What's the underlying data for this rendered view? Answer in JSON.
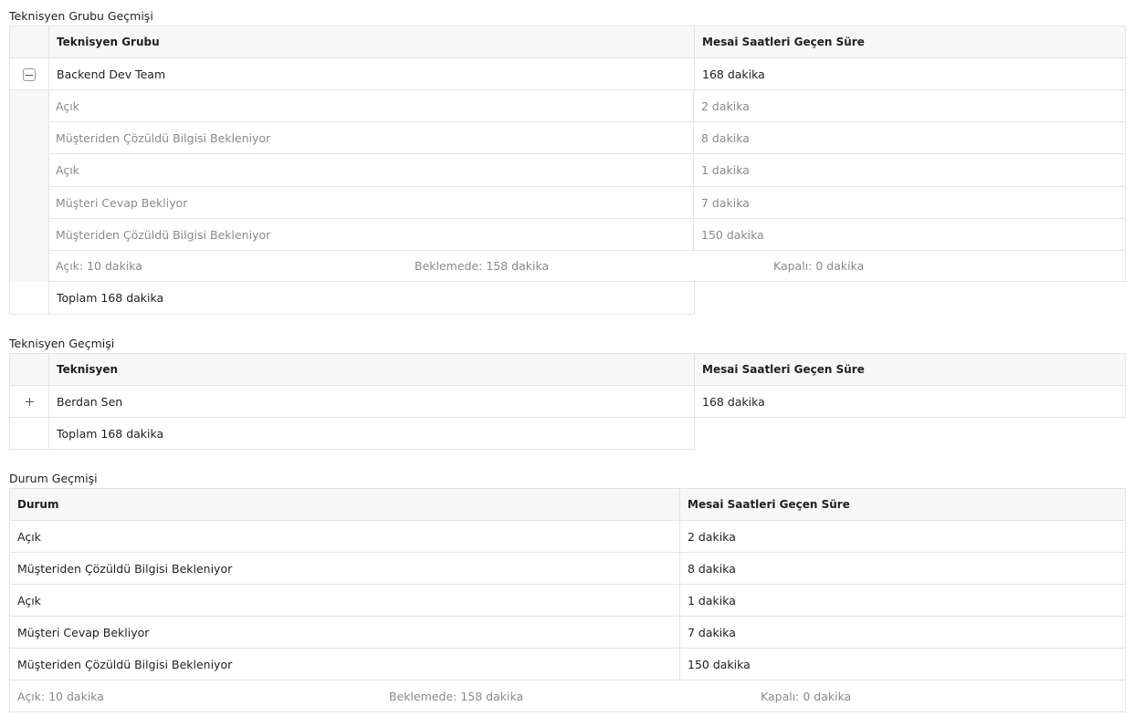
{
  "group_history": {
    "title": "Teknisyen Grubu Geçmişi",
    "col_group": "Teknisyen Grubu",
    "col_duration": "Mesai Saatleri Geçen Süre",
    "group_name": "Backend Dev Team",
    "group_duration": "168 dakika",
    "toggle_icon": "collapse-minus-icon",
    "sub_rows": [
      {
        "status": "Açık",
        "duration": "2 dakika"
      },
      {
        "status": "Müşteriden Çözüldü Bilgisi Bekleniyor",
        "duration": "8 dakika"
      },
      {
        "status": "Açık",
        "duration": "1 dakika"
      },
      {
        "status": "Müşteri Cevap Bekliyor",
        "duration": "7 dakika"
      },
      {
        "status": "Müşteriden Çözüldü Bilgisi Bekleniyor",
        "duration": "150 dakika"
      }
    ],
    "summary": {
      "open": "Açık: 10 dakika",
      "pending": "Beklemede: 158 dakika",
      "closed": "Kapalı: 0 dakika"
    },
    "total": "Toplam 168 dakika"
  },
  "technician_history": {
    "title": "Teknisyen Geçmişi",
    "col_technician": "Teknisyen",
    "col_duration": "Mesai Saatleri Geçen Süre",
    "technician_name": "Berdan Sen",
    "technician_duration": "168 dakika",
    "toggle_icon": "expand-plus-icon",
    "total": "Toplam 168 dakika"
  },
  "status_history": {
    "title": "Durum Geçmişi",
    "col_status": "Durum",
    "col_duration": "Mesai Saatleri Geçen Süre",
    "rows": [
      {
        "status": "Açık",
        "duration": "2 dakika"
      },
      {
        "status": "Müşteriden Çözüldü Bilgisi Bekleniyor",
        "duration": "8 dakika"
      },
      {
        "status": "Açık",
        "duration": "1 dakika"
      },
      {
        "status": "Müşteri Cevap Bekliyor",
        "duration": "7 dakika"
      },
      {
        "status": "Müşteriden Çözüldü Bilgisi Bekleniyor",
        "duration": "150 dakika"
      }
    ],
    "summary": {
      "open": "Açık: 10 dakika",
      "pending": "Beklemede: 158 dakika",
      "closed": "Kapalı: 0 dakika"
    }
  }
}
